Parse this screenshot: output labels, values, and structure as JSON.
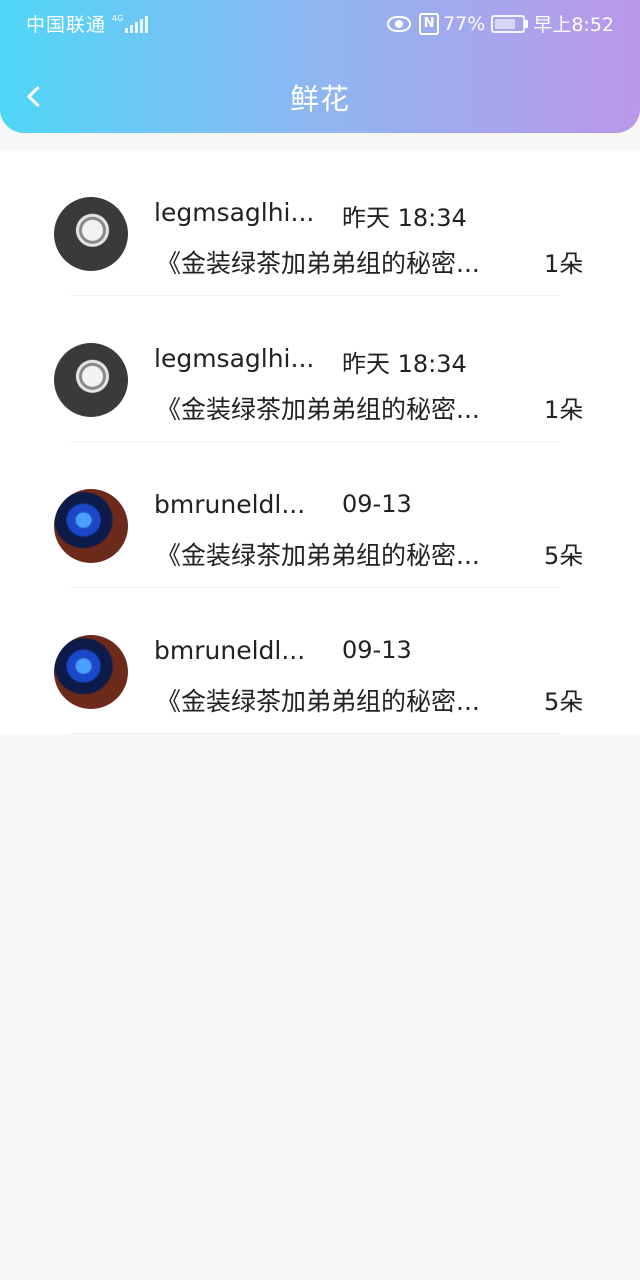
{
  "status_bar": {
    "carrier": "中国联通",
    "network": "4G",
    "battery": "77%",
    "time": "早上8:52"
  },
  "header": {
    "title": "鲜花"
  },
  "list": [
    {
      "avatar": "pocket-watch-avatar",
      "username": "legmsaglhi...",
      "time": "昨天 18:34",
      "message": "《金装绿茶加弟弟组的秘密...",
      "amount": "1朵"
    },
    {
      "avatar": "pocket-watch-avatar",
      "username": "legmsaglhi...",
      "time": "昨天 18:34",
      "message": "《金装绿茶加弟弟组的秘密...",
      "amount": "1朵"
    },
    {
      "avatar": "warrior-avatar",
      "username": "bmruneldl...",
      "time": "09-13",
      "message": "《金装绿茶加弟弟组的秘密...",
      "amount": "5朵"
    },
    {
      "avatar": "warrior-avatar",
      "username": "bmruneldl...",
      "time": "09-13",
      "message": "《金装绿茶加弟弟组的秘密...",
      "amount": "5朵"
    }
  ]
}
